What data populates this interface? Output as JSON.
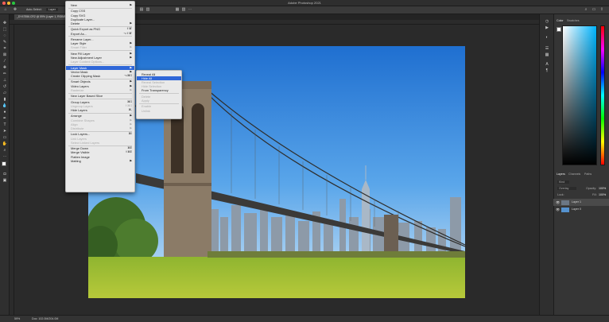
{
  "app": {
    "title": "Adobe Photoshop 2021"
  },
  "document": {
    "tab_label": "_DY47556.CR2 @ 59% (Layer 1, RGB/8)"
  },
  "options_bar": {
    "auto_select_label": "Auto-Select:",
    "auto_select_value": "Layer"
  },
  "status_bar": {
    "zoom": "59%",
    "doc_info": "Doc: 102.0M/204.0M"
  },
  "layer_menu": {
    "items": [
      {
        "label": "New",
        "shortcut": "",
        "submenu": true,
        "disabled": false
      },
      {
        "label": "Copy CSS",
        "shortcut": "",
        "submenu": false,
        "disabled": false
      },
      {
        "label": "Copy SVG",
        "shortcut": "",
        "submenu": false,
        "disabled": false
      },
      {
        "label": "Duplicate Layer...",
        "shortcut": "",
        "submenu": false,
        "disabled": false
      },
      {
        "label": "Delete",
        "shortcut": "",
        "submenu": true,
        "disabled": false
      },
      {
        "label": "Quick Export as PNG",
        "shortcut": "⇧⌘'",
        "submenu": false,
        "disabled": false
      },
      {
        "label": "Export As...",
        "shortcut": "⌥⇧⌘'",
        "submenu": false,
        "disabled": false
      },
      {
        "label": "Rename Layer...",
        "shortcut": "",
        "submenu": false,
        "disabled": false
      },
      {
        "label": "Layer Style",
        "shortcut": "",
        "submenu": true,
        "disabled": false
      },
      {
        "label": "Smart Filter",
        "shortcut": "",
        "submenu": true,
        "disabled": true
      },
      {
        "label": "New Fill Layer",
        "shortcut": "",
        "submenu": true,
        "disabled": false
      },
      {
        "label": "New Adjustment Layer",
        "shortcut": "",
        "submenu": true,
        "disabled": false
      },
      {
        "label": "Layer Content Options...",
        "shortcut": "",
        "submenu": false,
        "disabled": true
      },
      {
        "label": "Layer Mask",
        "shortcut": "",
        "submenu": true,
        "disabled": false,
        "highlighted": true
      },
      {
        "label": "Vector Mask",
        "shortcut": "",
        "submenu": true,
        "disabled": false
      },
      {
        "label": "Create Clipping Mask",
        "shortcut": "⌥⌘G",
        "submenu": false,
        "disabled": false
      },
      {
        "label": "Smart Objects",
        "shortcut": "",
        "submenu": true,
        "disabled": false
      },
      {
        "label": "Video Layers",
        "shortcut": "",
        "submenu": true,
        "disabled": false
      },
      {
        "label": "Rasterize",
        "shortcut": "",
        "submenu": true,
        "disabled": true
      },
      {
        "label": "New Layer Based Slice",
        "shortcut": "",
        "submenu": false,
        "disabled": false
      },
      {
        "label": "Group Layers",
        "shortcut": "⌘G",
        "submenu": false,
        "disabled": false
      },
      {
        "label": "Ungroup Layers",
        "shortcut": "⇧⌘G",
        "submenu": false,
        "disabled": true
      },
      {
        "label": "Hide Layers",
        "shortcut": "⌘,",
        "submenu": false,
        "disabled": false
      },
      {
        "label": "Arrange",
        "shortcut": "",
        "submenu": true,
        "disabled": false
      },
      {
        "label": "Combine Shapes",
        "shortcut": "",
        "submenu": true,
        "disabled": true
      },
      {
        "label": "Align",
        "shortcut": "",
        "submenu": true,
        "disabled": true
      },
      {
        "label": "Distribute",
        "shortcut": "",
        "submenu": true,
        "disabled": true
      },
      {
        "label": "Lock Layers...",
        "shortcut": "⌘/",
        "submenu": false,
        "disabled": false
      },
      {
        "label": "Link Layers",
        "shortcut": "",
        "submenu": false,
        "disabled": true
      },
      {
        "label": "Select Linked Layers",
        "shortcut": "",
        "submenu": false,
        "disabled": true
      },
      {
        "label": "Merge Down",
        "shortcut": "⌘E",
        "submenu": false,
        "disabled": false
      },
      {
        "label": "Merge Visible",
        "shortcut": "⇧⌘E",
        "submenu": false,
        "disabled": false
      },
      {
        "label": "Flatten Image",
        "shortcut": "",
        "submenu": false,
        "disabled": false
      },
      {
        "label": "Matting",
        "shortcut": "",
        "submenu": true,
        "disabled": false
      }
    ]
  },
  "layer_mask_submenu": {
    "items": [
      {
        "label": "Reveal All",
        "disabled": false
      },
      {
        "label": "Hide All",
        "disabled": false,
        "highlighted": true
      },
      {
        "label": "Reveal Selection",
        "disabled": true
      },
      {
        "label": "Hide Selection",
        "disabled": true
      },
      {
        "label": "From Transparency",
        "disabled": false
      },
      {
        "label": "Delete",
        "disabled": true
      },
      {
        "label": "Apply",
        "disabled": true
      },
      {
        "label": "Enable",
        "disabled": true
      },
      {
        "label": "Unlink",
        "disabled": true
      }
    ]
  },
  "color_panel": {
    "tabs": [
      "Color",
      "Swatches"
    ]
  },
  "layers_panel": {
    "tabs": [
      "Layers",
      "Channels",
      "Paths"
    ],
    "kind_label": "Kind",
    "blend_mode": "Overlay",
    "opacity_label": "Opacity:",
    "opacity_value": "100%",
    "lock_label": "Lock:",
    "fill_label": "Fill:",
    "fill_value": "100%",
    "layers": [
      {
        "name": "Layer 1",
        "selected": true
      },
      {
        "name": "Layer 0",
        "selected": false
      }
    ]
  },
  "colors": {
    "menu_highlight": "#2f67d8",
    "menu_bg": "#e9e9e9"
  }
}
